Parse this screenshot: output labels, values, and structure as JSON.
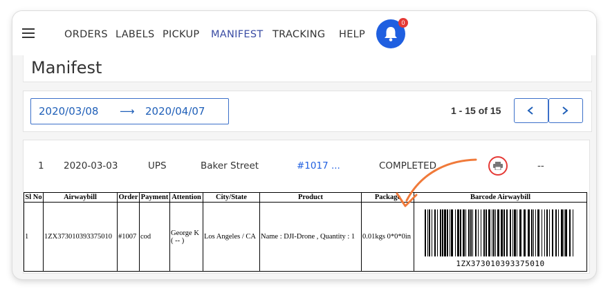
{
  "nav": {
    "items": [
      {
        "label": "ORDERS",
        "active": false
      },
      {
        "label": "LABELS",
        "active": false
      },
      {
        "label": "PICKUP",
        "active": false
      },
      {
        "label": "MANIFEST",
        "active": true
      },
      {
        "label": "TRACKING",
        "active": false
      },
      {
        "label": "HELP",
        "active": false
      }
    ],
    "notification_count": "0",
    "accent_color": "#1f5fe0"
  },
  "page": {
    "title": "Manifest"
  },
  "filter": {
    "date_from": "2020/03/08",
    "date_to": "2020/04/07",
    "page_count": "1 - 15 of 15"
  },
  "manifest_row": {
    "index": "1",
    "date": "2020-03-03",
    "carrier": "UPS",
    "pickup_location": "Baker Street",
    "order_link": "#1017 ...",
    "status": "COMPLETED",
    "extra": "--"
  },
  "slip": {
    "headers": [
      "Sl No",
      "Airwaybill",
      "Order",
      "Payment",
      "Attention",
      "City/State",
      "Product",
      "Package",
      "Barcode Airwaybill"
    ],
    "row": {
      "sl_no": "1",
      "airwaybill": "1ZX373010393375010",
      "order": "#1007",
      "payment": "cod",
      "attention_line1": "George K",
      "attention_line2": "( -- )",
      "city_state": "Los Angeles / CA",
      "product": "Name : DJI-Drone , Quantity : 1",
      "package": "0.01kgs 0*0*0in",
      "barcode_text": "1ZX373010393375010"
    }
  },
  "icons": {
    "menu": "hamburger-icon",
    "bell": "bell-icon",
    "prev": "chevron-left-icon",
    "next": "chevron-right-icon",
    "print": "printer-icon",
    "annotation": "annotation-arrow-icon"
  },
  "annotation_color": "#f07a3a"
}
